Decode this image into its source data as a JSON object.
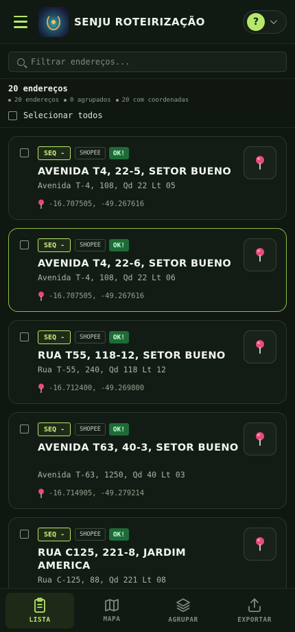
{
  "header": {
    "title": "SENJU ROTEIRIZAÇÃO",
    "help_label": "?"
  },
  "search": {
    "placeholder": "Filtrar endereços..."
  },
  "summary": {
    "count_label": "20 endereços",
    "stats": [
      "20 endereços",
      "0 agrupados",
      "20 com coordenadas"
    ],
    "select_all_label": "Selecionar todos"
  },
  "addresses": [
    {
      "seq_label": "SEQ -",
      "source": "SHOPEE",
      "status": "OK!",
      "title": "AVENIDA T4, 22-5, SETOR BUENO",
      "subtitle": "Avenida T-4, 108, Qd 22 Lt 05",
      "coords": "-16.707505, -49.267616",
      "selected": false
    },
    {
      "seq_label": "SEQ -",
      "source": "SHOPEE",
      "status": "OK!",
      "title": "AVENIDA T4, 22-6, SETOR BUENO",
      "subtitle": "Avenida T-4, 108, Qd 22 Lt 06",
      "coords": "-16.707505, -49.267616",
      "selected": true
    },
    {
      "seq_label": "SEQ -",
      "source": "SHOPEE",
      "status": "OK!",
      "title": "RUA T55, 118-12, SETOR BUENO",
      "subtitle": "Rua T-55, 240, Qd 118 Lt 12",
      "coords": "-16.712400, -49.269800",
      "selected": false
    },
    {
      "seq_label": "SEQ -",
      "source": "SHOPEE",
      "status": "OK!",
      "title": "AVENIDA T63, 40-3, SETOR BUENO",
      "subtitle": "Avenida T-63, 1250, Qd 40 Lt 03",
      "coords": "-16.714905, -49.279214",
      "selected": false
    },
    {
      "seq_label": "SEQ -",
      "source": "SHOPEE",
      "status": "OK!",
      "title": "RUA C125, 221-8, JARDIM AMERICA",
      "subtitle": "Rua C-125, 88, Qd 221 Lt 08",
      "coords": "",
      "selected": false
    }
  ],
  "nav": [
    {
      "label": "LISTA",
      "icon": "clipboard-list-icon",
      "active": true
    },
    {
      "label": "MAPA",
      "icon": "map-icon",
      "active": false
    },
    {
      "label": "AGRUPAR",
      "icon": "layers-icon",
      "active": false
    },
    {
      "label": "EXPORTAR",
      "icon": "upload-icon",
      "active": false
    }
  ],
  "colors": {
    "accent": "#b5e86a",
    "background": "#0f1710",
    "ok": "#1e6b37",
    "pin": "#e84a7a"
  }
}
